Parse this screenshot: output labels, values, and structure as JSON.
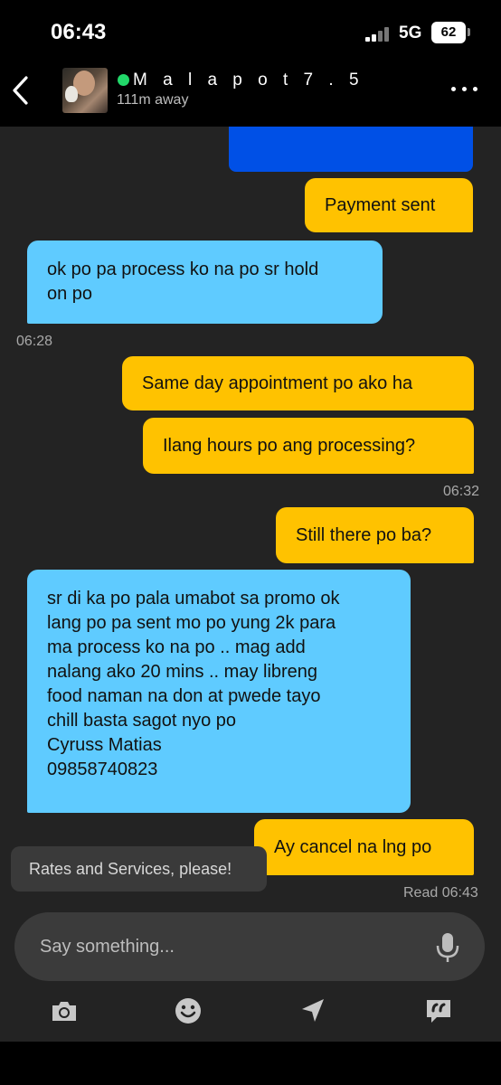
{
  "status_bar": {
    "time": "06:43",
    "network": "5G",
    "battery": "62"
  },
  "header": {
    "name": "M a l a p o t 7 . 5",
    "distance": "111m away"
  },
  "messages": [
    {
      "text": "Payment sent"
    },
    {
      "text": "ok po pa process ko na po sr hold\non po"
    },
    {
      "text": "Same day appointment po ako ha"
    },
    {
      "text": "Ilang hours po ang processing?"
    },
    {
      "text": "Still there po ba?"
    },
    {
      "text": "sr di ka po pala umabot sa promo ok\nlang po pa sent mo po yung 2k para\nma process ko na po .. mag add\nnalang ako 20 mins .. may libreng\nfood naman na don at pwede tayo\nchill basta sagot nyo po\nCyruss Matias\n09858740823"
    },
    {
      "text": "Ay cancel na lng po"
    }
  ],
  "timestamps": {
    "t1": "06:28",
    "t2": "06:32",
    "read": "Read 06:43"
  },
  "suggestion": "Rates and Services, please!",
  "composer": {
    "placeholder": "Say something..."
  },
  "colors": {
    "outgoing": "#ffc200",
    "incoming": "#5fcbff",
    "online": "#22d86a",
    "media": "#0050e6"
  }
}
